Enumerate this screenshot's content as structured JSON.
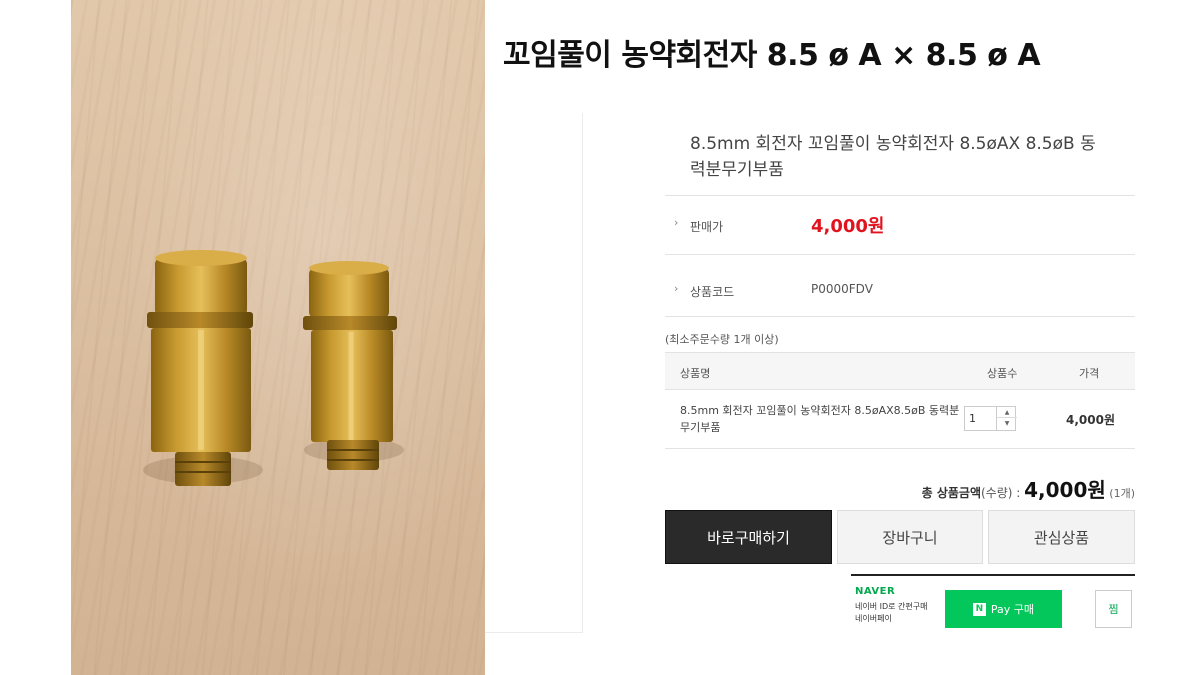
{
  "headline": "꼬임풀이 농약회전자 8.5 ø A × 8.5 ø A",
  "product": {
    "title": "8.5mm 회전자 꼬임풀이 농약회전자 8.5øAX 8.5øB 동력분무기부품"
  },
  "details": {
    "price_label": "판매가",
    "price_value": "4,000원",
    "code_label": "상품코드",
    "code_value": "P0000FDV",
    "bullet": "›"
  },
  "min_order": "(최소주문수량 1개 이상)",
  "options_table": {
    "headers": [
      "상품명",
      "상품수",
      "가격"
    ],
    "rows": [
      {
        "name": "8.5mm 회전자 꼬임풀이 농약회전자 8.5øAX8.5øB 동력분무기부품",
        "qty": "1",
        "price": "4,000원"
      }
    ]
  },
  "total": {
    "label": "총 상품금액",
    "sub": "(수량) : ",
    "price": "4,000원",
    "count": " (1개)"
  },
  "buttons": {
    "buy_now": "바로구매하기",
    "cart": "장바구니",
    "wishlist": "관심상품"
  },
  "naver_pay": {
    "logo": "NAVER",
    "desc_line1": "네이버 ID로 간편구매",
    "desc_line2": "네이버페이",
    "n_mark": "N",
    "button_label": "Pay 구매",
    "zzim": "찜"
  },
  "qty_controls": {
    "up": "▲",
    "down": "▼"
  },
  "colors": {
    "price_red": "#e0141e",
    "naver_green": "#03c75a",
    "buy_button_bg": "#2a2a2a"
  }
}
